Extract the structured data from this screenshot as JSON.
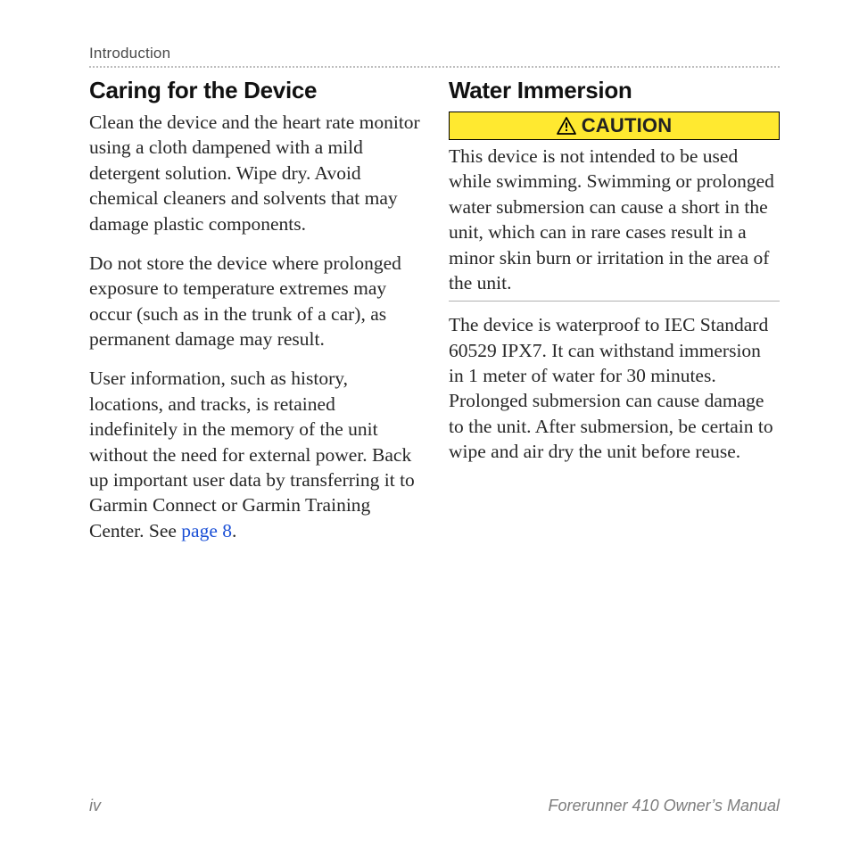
{
  "header": {
    "section": "Introduction"
  },
  "columns": {
    "left": {
      "heading": "Caring for the Device",
      "p1": "Clean the device and the heart rate monitor using a cloth dampened with a mild detergent solution. Wipe dry. Avoid chemical cleaners and solvents that may damage plastic components.",
      "p2": "Do not store the device where prolonged exposure to temperature extremes may occur (such as in the trunk of a car), as permanent damage may result.",
      "p3_pre": "User information, such as history, locations, and tracks, is retained indefinitely in the memory of the unit without the need for external power. Back up important user data by transferring it to Garmin Connect or Garmin Training Center. See ",
      "p3_link": "page 8",
      "p3_post": "."
    },
    "right": {
      "heading": "Water Immersion",
      "caution_label": "CAUTION",
      "caution_text": "This device is not intended to be used while swimming. Swimming or prolonged water submersion can cause a short in the unit, which can in rare cases result in a minor skin burn or irritation in the area of the unit.",
      "p1": "The device is waterproof to IEC Standard 60529 IPX7. It can withstand immersion in 1 meter of water for 30 minutes. Prolonged submersion can cause damage to the unit. After submersion, be certain to wipe and air dry the unit before reuse."
    }
  },
  "footer": {
    "page_number": "iv",
    "doc_title": "Forerunner 410 Owner’s Manual"
  }
}
